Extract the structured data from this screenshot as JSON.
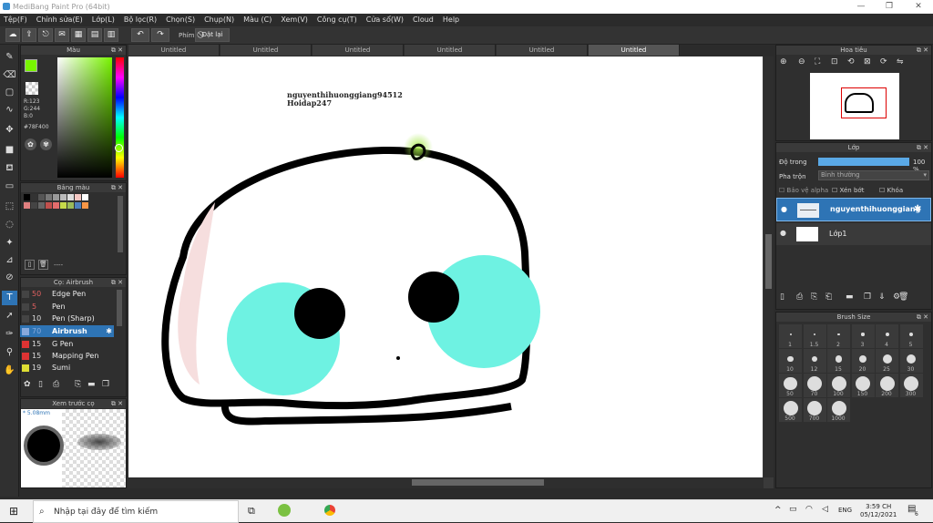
{
  "window": {
    "title": "MediBang Paint Pro (64bit)",
    "min": "—",
    "max": "❐",
    "close": "✕"
  },
  "menu": [
    "Tệp(F)",
    "Chỉnh sửa(E)",
    "Lớp(L)",
    "Bộ lọc(R)",
    "Chọn(S)",
    "Chụp(N)",
    "Màu (C)",
    "Xem(V)",
    "Công cụ(T)",
    "Cửa sổ(W)",
    "Cloud",
    "Help"
  ],
  "toolbar": {
    "key_label": "Phím",
    "reset_label": "Đặt lại"
  },
  "tabs": [
    "Untitled",
    "Untitled",
    "Untitled",
    "Untitled",
    "Untitled",
    "Untitled"
  ],
  "color_panel": {
    "title": "Màu",
    "r": "R:123",
    "g": "G:244",
    "b": "B:0",
    "hex": "#78F400",
    "fg": "#78f400",
    "bg": "#000000"
  },
  "palette_panel": {
    "title": "Bảng màu",
    "colors": [
      "#000000",
      "#333333",
      "#555555",
      "#777777",
      "#999999",
      "#bbbbbb",
      "#dddddd",
      "#f4c7c3",
      "#ffffff",
      "#e08080",
      "#444444",
      "#666666",
      "#c0504d",
      "#e46c6c",
      "#c6d94a",
      "#9bbb59",
      "#4f81bd",
      "#f79646"
    ],
    "note": "----"
  },
  "brush_panel": {
    "title": "Cọ: Airbrush",
    "items": [
      {
        "size": "50",
        "name": "Edge Pen",
        "color": "#444444"
      },
      {
        "size": "5",
        "name": "Pen",
        "color": "#444444"
      },
      {
        "size": "10",
        "name": "Pen (Sharp)",
        "color": "#444444"
      },
      {
        "size": "70",
        "name": "Airbrush",
        "color": "#88aadd"
      },
      {
        "size": "15",
        "name": "G Pen",
        "color": "#dd3333"
      },
      {
        "size": "15",
        "name": "Mapping Pen",
        "color": "#dd3333"
      },
      {
        "size": "19",
        "name": "Sumi",
        "color": "#dddd33"
      }
    ]
  },
  "preview_panel": {
    "title": "Xem trước cọ",
    "size": "5.08mm"
  },
  "canvas": {
    "text_line1": "nguyenthihuonggiang94512",
    "text_line2": "Hoidap247"
  },
  "navigator_panel": {
    "title": "Hoa tiêu"
  },
  "layer_panel": {
    "title": "Lớp",
    "opacity_label": "Độ trong",
    "opacity_value": "100 %",
    "opacity": 1.0,
    "blend_label": "Pha trộn",
    "blend_value": "Bình thường",
    "protect_alpha": "Bảo vệ alpha",
    "clipping": "Xén bớt",
    "lock": "Khóa",
    "layers": [
      {
        "name": "nguyenthihuonggiang",
        "selected": true
      },
      {
        "name": "Lớp1",
        "selected": false
      }
    ]
  },
  "brush_size_panel": {
    "title": "Brush Size",
    "sizes": [
      "1",
      "1.5",
      "2",
      "3",
      "4",
      "5",
      "10",
      "12",
      "15",
      "20",
      "25",
      "30",
      "50",
      "70",
      "100",
      "150",
      "200",
      "300",
      "500",
      "700",
      "1000"
    ]
  },
  "taskbar": {
    "search_placeholder": "Nhập tại đây để tìm kiếm",
    "lang": "ENG",
    "time": "3:59 CH",
    "date": "05/12/2021",
    "notif": "6"
  }
}
